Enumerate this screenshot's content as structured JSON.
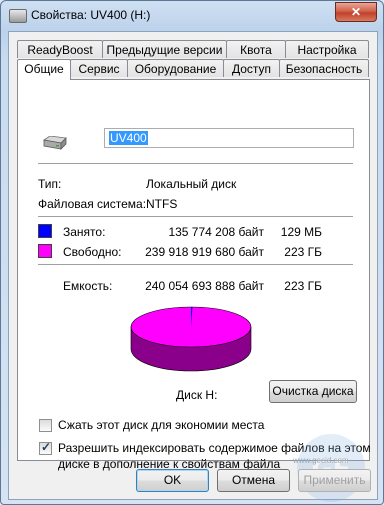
{
  "window": {
    "title": "Свойства: UV400 (H:)",
    "close_glyph": "✕"
  },
  "tabs": {
    "back_row": [
      "ReadyBoost",
      "Предыдущие версии",
      "Квота",
      "Настройка"
    ],
    "front_row": [
      "Общие",
      "Сервис",
      "Оборудование",
      "Доступ",
      "Безопасность"
    ],
    "active": "Общие"
  },
  "general": {
    "volume_label": "UV400",
    "type_label": "Тип:",
    "type_value": "Локальный диск",
    "fs_label": "Файловая система:",
    "fs_value": "NTFS",
    "used_label": "Занято:",
    "used_bytes": "135 774 208 байт",
    "used_short": "129 МБ",
    "free_label": "Свободно:",
    "free_bytes": "239 918 919 680 байт",
    "free_short": "223 ГБ",
    "capacity_label": "Емкость:",
    "capacity_bytes": "240 054 693 888 байт",
    "capacity_short": "223 ГБ",
    "disk_caption": "Диск H:",
    "cleanup_button": "Очистка диска",
    "compress_label": "Сжать этот диск для экономии места",
    "compress_checked": false,
    "index_label_line1": "Разрешить индексировать содержимое файлов на этом",
    "index_label_line2": "диске в дополнение к свойствам файла",
    "index_checked": true,
    "used_fraction": 0.000566,
    "colors": {
      "used": "#0000ff",
      "free": "#ff00ff",
      "free_side": "#8b008b"
    }
  },
  "buttons": {
    "ok": "OK",
    "cancel": "Отмена",
    "apply": "Применить"
  },
  "watermark": {
    "text": "www.gecid.com"
  }
}
